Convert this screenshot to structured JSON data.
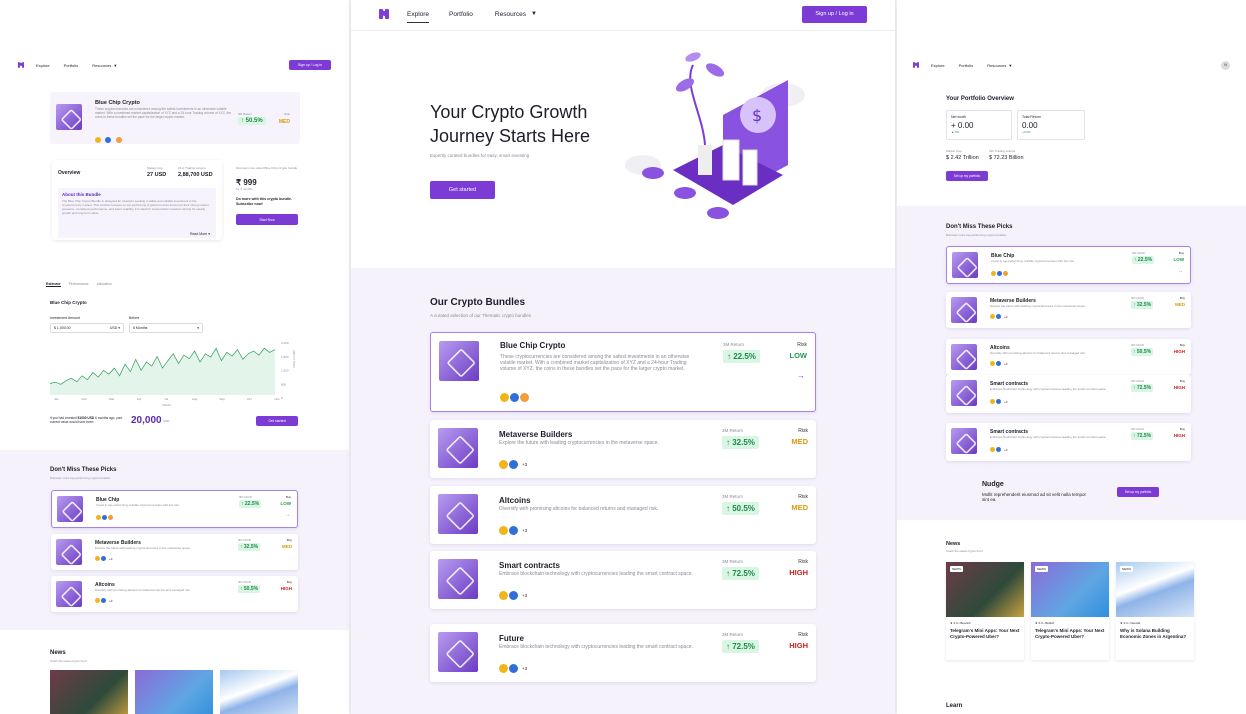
{
  "nav": {
    "explore": "Explore",
    "portfolio": "Portfolio",
    "resources": "Resources",
    "signup": "Sign up / Log in",
    "avatar": "N"
  },
  "hero": {
    "title_line1": "Your Crypto Growth",
    "title_line2": "Journey Starts Here",
    "subtitle": "Expertly curated bundles for easy, smart investing",
    "cta": "Get started"
  },
  "bundles_section": {
    "title": "Our Crypto Bundles",
    "subtitle": "A curated selection of our Thematic crypto bundles"
  },
  "bundles": [
    {
      "name": "Blue Chip Crypto",
      "desc": "These cryptocurrencies are considered among the safest investments in an otherwise volatile market. With a combined market capitalization of XYZ and a 24-hour Trading volume of XYZ, the coins in these bundles set the pace for the larger crypto market.",
      "return_label": "3M Return",
      "return": "22.5%",
      "risk_label": "Risk",
      "risk": "LOW",
      "more": ""
    },
    {
      "name": "Metaverse Builders",
      "desc": "Explore the future with leading cryptocurrencies in the metaverse space.",
      "return_label": "3M Return",
      "return": "32.5%",
      "risk_label": "Risk",
      "risk": "MED",
      "more": "+3"
    },
    {
      "name": "Altcoins",
      "desc": "Diversify with promising altcoins for balanced returns and managed risk.",
      "return_label": "3M Return",
      "return": "50.5%",
      "risk_label": "Risk",
      "risk": "MED",
      "more": "+3"
    },
    {
      "name": "Smart contracts",
      "desc": "Embrace blockchain technology with cryptocurrencies leading the smart contract space.",
      "return_label": "3M Return",
      "return": "72.5%",
      "risk_label": "Risk",
      "risk": "HIGH",
      "more": "+3"
    },
    {
      "name": "Future",
      "desc": "Embrace blockchain technology with cryptocurrencies leading the smart contract space.",
      "return_label": "3M Return",
      "return": "72.5%",
      "risk_label": "Risk",
      "risk": "HIGH",
      "more": "+3"
    }
  ],
  "detail": {
    "name": "Blue Chip Crypto",
    "desc": "These cryptocurrencies are considered among the safest investments in an otherwise volatile market. With a combined market capitalization of XYZ and a 24-hour Trading volume of XYZ, the coins in these bundles set the pace for the larger crypto market.",
    "return_label": "3M Return",
    "return": "50.5%",
    "risk_label": "Risk",
    "risk": "MED",
    "overview": "Overview",
    "market_cap_label": "Market Cap",
    "market_cap": "27 USD",
    "volume_label": "24 H Trading volume",
    "volume": "2,88,700 USD",
    "about_title": "About this Bundle",
    "about_text": "The Blue Chip Crypto Bundle is designed for investors seeking a stable and reliable investment in the cryptocurrency market. This portfolio focuses on top-performing cryptocurrencies known for their strong market presence, consistent performance, and lower volatility. It is ideal for conservative investors aiming for steady growth and long-term value.",
    "read_more": "Read More",
    "discover": "Discover more about Blue Chip Crypto bundle",
    "price": "₹ 999",
    "price_period": "for 3 months",
    "do_more": "Do more with this crypto bundle. Subscribe now!",
    "start": "Start Now"
  },
  "estimate": {
    "tabs": [
      "Estimate",
      "Performance",
      "Allocation"
    ],
    "chart_title": "Blue Chip Crypto",
    "amount_label": "Investment Amount",
    "amount": "1,000.00",
    "currency": "USD",
    "before_label": "Before",
    "before": "6 Months",
    "note_prefix": "If you had invested",
    "note_amount": "$1000 USD",
    "note_suffix": "6 months ago, your current value would have been",
    "result": "20,000",
    "result_unit": "USD",
    "cta": "Get started"
  },
  "chart_data": {
    "type": "line",
    "x": [
      "Jan",
      "Feb",
      "Mar",
      "Apr",
      "Jul",
      "Aug",
      "Sep",
      "Oct",
      "Nov"
    ],
    "xlabel": "Month",
    "ylabel": "Price in USD",
    "yticks": [
      "2,000",
      "1,500",
      "1,000",
      "500",
      "0"
    ],
    "values": [
      420,
      470,
      390,
      520,
      610,
      480,
      700,
      560,
      820,
      650,
      900,
      760,
      980,
      700,
      1120,
      850,
      1300,
      900,
      1200,
      1050,
      1400,
      980,
      1250,
      1500,
      1150,
      1450,
      1320,
      1600,
      1200,
      1500,
      1380,
      1700,
      1250,
      1550,
      1420,
      1650,
      1300,
      1500,
      1600,
      1450,
      1700,
      1550,
      1650
    ]
  },
  "picks": {
    "title": "Don't Miss These Picks",
    "subtitle": "Discover more top-performing crypto bundles",
    "buy": "Buy",
    "items": [
      {
        "name": "Blue Chip",
        "desc": "Invest in top-performing, reliable cryptocurrencies with low risk.",
        "return_label": "3M CAGR",
        "return": "22.5%",
        "risk": "LOW",
        "more": ""
      },
      {
        "name": "Metaverse Builders",
        "desc": "Explore the future with leading cryptocurrencies in the metaverse space.",
        "return_label": "3M CAGR",
        "return": "32.5%",
        "risk": "MED",
        "more": "+3"
      },
      {
        "name": "Altcoins",
        "desc": "Diversify with promising altcoins for balanced returns and managed risk.",
        "return_label": "3M CAGR",
        "return": "50.5%",
        "risk": "HIGH",
        "more": "+3"
      },
      {
        "name": "Smart contracts",
        "desc": "Embrace blockchain technology with cryptocurrencies leading the smart contract space.",
        "return_label": "3M CAGR",
        "return": "72.5%",
        "risk": "HIGH",
        "more": "+3"
      },
      {
        "name": "Smart contracts",
        "desc": "Embrace blockchain technology with cryptocurrencies leading the smart contract space.",
        "return_label": "3M CAGR",
        "return": "72.5%",
        "risk": "HIGH",
        "more": "+3"
      }
    ]
  },
  "portfolio": {
    "title": "Your Portfolio Overview",
    "net_worth_label": "Net worth",
    "net_worth": "+ 0.00",
    "net_change": "▲ 0%",
    "total_return_label": "Total Return",
    "total_return": "0.00",
    "total_change": "+0.0%",
    "market_cap_label": "Market Cap",
    "market_cap": "$ 2.42 Trillion",
    "volume_label": "24h Trading volume",
    "volume": "$ 72.23 Billion",
    "cta": "Set up my portfolio"
  },
  "nudge": {
    "title": "Nudge",
    "text": "Mollit reprehenderit eiusmod ad sit velit nulla tempor sint ea.",
    "cta": "Set up my portfolio"
  },
  "news": {
    "title": "News",
    "subtitle": "Catch the latest crypto buzz",
    "items": [
      {
        "tag": "NEWS",
        "meta": "4.3 • Bearish",
        "title": "Telegram's Mini Apps: Your Next Crypto-Powered Uber?"
      },
      {
        "tag": "NEWS",
        "meta": "4.3 • Bullish",
        "title": "Telegram's Mini Apps: Your Next Crypto-Powered Uber?"
      },
      {
        "tag": "NEWS",
        "meta": "4.3 • Neutral",
        "title": "Why is Solana Building Economic Zones in Argentina?"
      }
    ]
  },
  "learn": {
    "title": "Learn"
  },
  "colors": {
    "accent": "#7d3bd6",
    "low": "#1d9b50",
    "med": "#d99a12",
    "high": "#d21c1c"
  }
}
